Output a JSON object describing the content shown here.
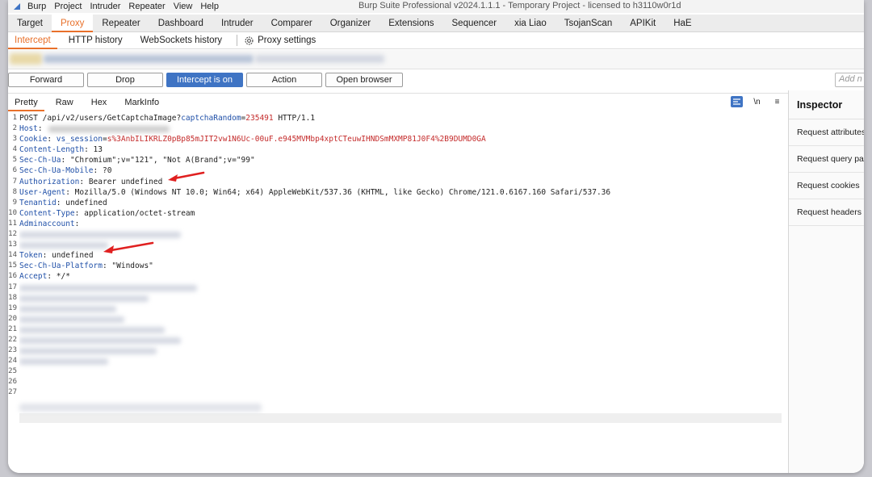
{
  "menubar": {
    "items": [
      "Burp",
      "Project",
      "Intruder",
      "Repeater",
      "View",
      "Help"
    ],
    "title": "Burp Suite Professional v2024.1.1.1 - Temporary Project - licensed to h3110w0r1d"
  },
  "main_tabs": [
    "Target",
    "Proxy",
    "Repeater",
    "Dashboard",
    "Intruder",
    "Comparer",
    "Organizer",
    "Extensions",
    "Sequencer",
    "xia Liao",
    "TsojanScan",
    "APIKit",
    "HaE"
  ],
  "sub_tabs": [
    "Intercept",
    "HTTP history",
    "WebSockets history"
  ],
  "proxy_settings_label": "Proxy settings",
  "toolbar": {
    "forward": "Forward",
    "drop": "Drop",
    "intercept": "Intercept is on",
    "action": "Action",
    "open_browser": "Open browser",
    "note_placeholder": "Add n"
  },
  "view_tabs": [
    "Pretty",
    "Raw",
    "Hex",
    "MarkInfo"
  ],
  "view_icons": {
    "newline": "\\n",
    "menu": "≡"
  },
  "request": {
    "line_numbers": [
      "1",
      "2",
      "3",
      "4",
      "5",
      "6",
      "7",
      "8",
      "9",
      "10",
      "11",
      "12",
      "13",
      "14",
      "15",
      "16",
      "17",
      "18",
      "19",
      "20",
      "21",
      "22",
      "23",
      "24",
      "25",
      "26",
      "27"
    ],
    "request_line": {
      "prefix": "POST /api/v2/users/GetCaptchaImage?",
      "param_name": "captchaRandom",
      "eq": "=",
      "param_value": "235491",
      "suffix": " HTTP/1.1"
    },
    "host_key": "Host",
    "cookie": {
      "key": "Cookie",
      "name": "vs_session",
      "value": "s%3AnbILIKRLZ0pBp85mJIT2vw1N6Uc-00uF.e945MVMbp4xptCTeuwIHNDSmMXMP81J0F4%2B9DUMD0GA"
    },
    "headers_mid": [
      {
        "key": "Content-Length",
        "value": " 13"
      },
      {
        "key": "Sec-Ch-Ua",
        "value": " \"Chromium\";v=\"121\", \"Not A(Brand\";v=\"99\""
      },
      {
        "key": "Sec-Ch-Ua-Mobile",
        "value": " ?0"
      },
      {
        "key": "Authorization",
        "value": " Bearer undefined"
      },
      {
        "key": "User-Agent",
        "value": " Mozilla/5.0 (Windows NT 10.0; Win64; x64) AppleWebKit/537.36 (KHTML, like Gecko) Chrome/121.0.6167.160 Safari/537.36"
      },
      {
        "key": "Tenantid",
        "value": " undefined"
      },
      {
        "key": "Content-Type",
        "value": " application/octet-stream"
      },
      {
        "key": "Adminaccount",
        "value": ""
      }
    ],
    "headers_end": [
      {
        "key": "Token",
        "value": " undefined"
      },
      {
        "key": "Sec-Ch-Ua-Platform",
        "value": " \"Windows\""
      },
      {
        "key": "Accept",
        "value": " */*"
      }
    ],
    "colon": ":"
  },
  "inspector": {
    "title": "Inspector",
    "items": [
      "Request attributes",
      "Request query parameters",
      "Request cookies",
      "Request headers"
    ]
  },
  "colors": {
    "accent": "#e8702a",
    "primary_button": "#3f74c4",
    "header_key": "#2050a8",
    "value_red": "#c42b2b",
    "annotation_arrow": "#e02020"
  }
}
